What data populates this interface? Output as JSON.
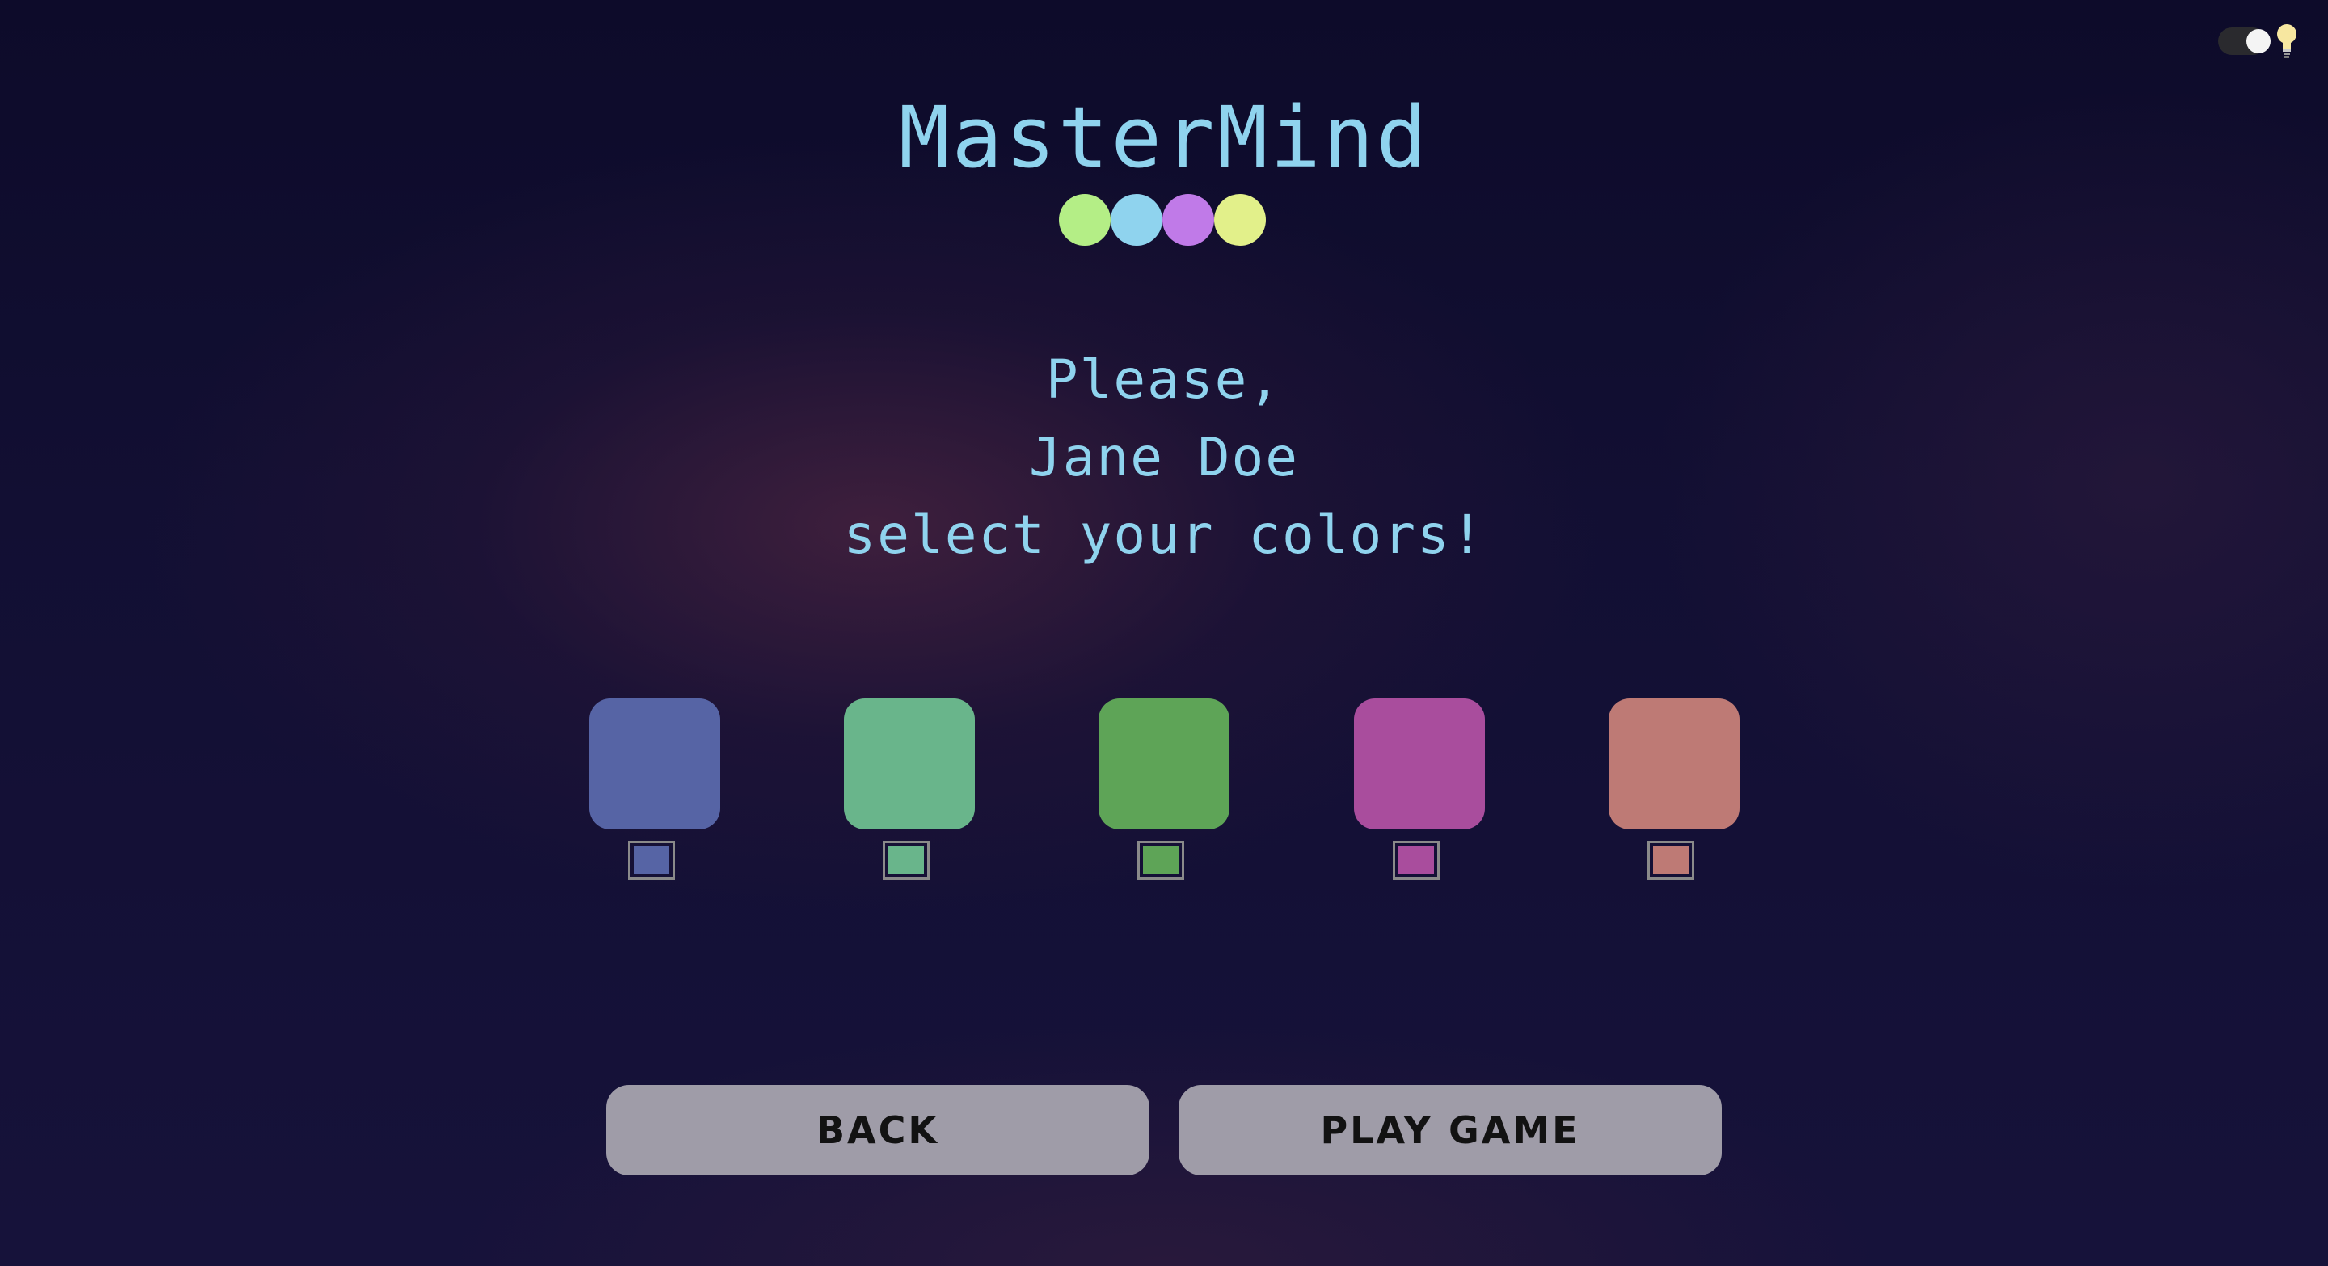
{
  "game": {
    "title": "MasterMind",
    "logo_dots": [
      "#b4ee86",
      "#8fd3ee",
      "#c07ae8",
      "#e2f08a"
    ]
  },
  "prompt": {
    "line1": "Please,",
    "player_name": "Jane Doe",
    "line3": "select your colors!"
  },
  "colors": [
    {
      "name": "blue",
      "hex": "#5664a5"
    },
    {
      "name": "mint",
      "hex": "#69b58b"
    },
    {
      "name": "green",
      "hex": "#5ea457"
    },
    {
      "name": "magenta",
      "hex": "#a94d9d"
    },
    {
      "name": "salmon",
      "hex": "#be7a75"
    }
  ],
  "buttons": {
    "back": "BACK",
    "play": "PLAY GAME"
  },
  "theme_toggle": {
    "icon": "lightbulb-icon",
    "state": "on"
  }
}
